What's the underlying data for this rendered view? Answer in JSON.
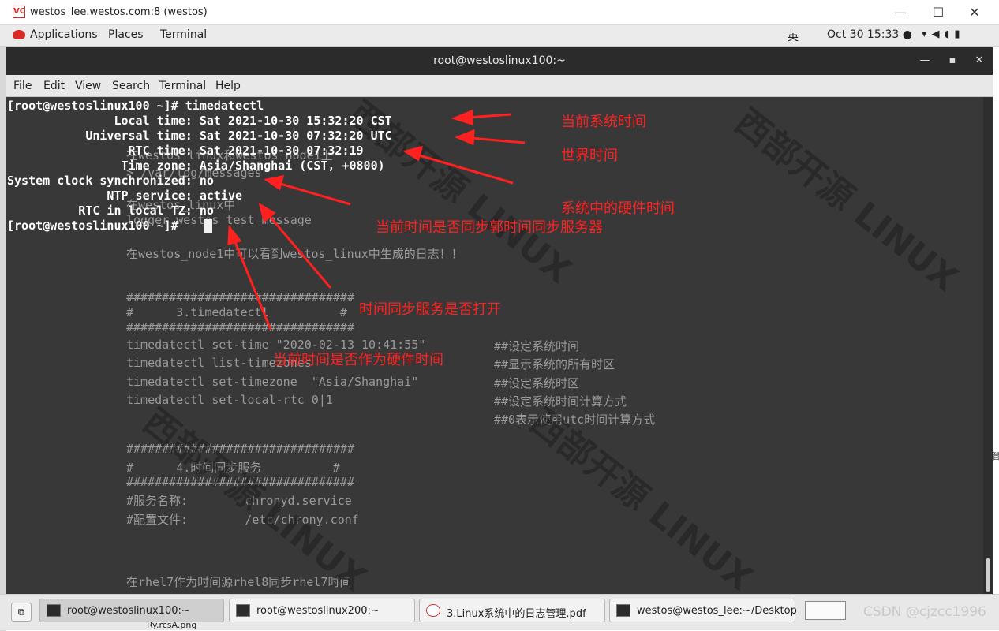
{
  "outer_window": {
    "icon_text": "VC",
    "title": "westos_lee.westos.com:8 (westos)"
  },
  "gnome_bar": {
    "applications": "Applications",
    "places": "Places",
    "terminal": "Terminal",
    "ime": "英",
    "clock": "Oct 30  15:33 ●",
    "tray": "▾◀◖▮"
  },
  "terminal_window": {
    "title": "root@westoslinux100:~",
    "menu": [
      "File",
      "Edit",
      "View",
      "Search",
      "Terminal",
      "Help"
    ]
  },
  "terminal_lines": [
    "[root@westoslinux100 ~]# timedatectl",
    "               Local time: Sat 2021-10-30 15:32:20 CST",
    "           Universal time: Sat 2021-10-30 07:32:20 UTC",
    "                 RTC time: Sat 2021-10-30 07:32:19",
    "                Time zone: Asia/Shanghai (CST, +0800)",
    "System clock synchronized: no",
    "              NTP service: active",
    "          RTC in local TZ: no",
    "[root@westoslinux100 ~]# "
  ],
  "background_doc": {
    "l1": "在westos_linux和westos_node1上",
    "l2": "> /var/log/messages",
    "l3": "在westos_linux中",
    "l4": "logger westos test message",
    "l5": "在westos_node1中可以看到westos_linux中生成的日志！！",
    "hashes": "################################",
    "sec3": "#      3.timedatectl          #",
    "cmd1": "timedatectl set-time \"2020-02-13 10:41:55\"",
    "cmd1c": "##设定系统时间",
    "cmd2": "timedatectl list-timezones",
    "cmd2c": "##显示系统的所有时区",
    "cmd3": "timedatectl set-timezone  \"Asia/Shanghai\"",
    "cmd3c": "##设定系统时区",
    "cmd4": "timedatectl set-local-rtc 0|1",
    "cmd4c": "##设定系统时间计算方式",
    "cmd5c": "##0表示使用utc时间计算方式",
    "sec4": "#      4.时间同步服务          #",
    "svc": "#服务名称:        chronyd.service",
    "conf": "#配置文件:        /etc/chrony.conf",
    "last": "在rhel7作为时间源rhel8同步rhel7时间"
  },
  "watermark": {
    "text": "西部开源 LINUX"
  },
  "annotations": {
    "a1": "当前系统时间",
    "a2": "世界时间",
    "a3": "系统中的硬件时间",
    "a4": "当前时间是否同步郭时间同步服务器",
    "a5": "时间同步服务是否打开",
    "a6": "当前时间是否作为硬件时间"
  },
  "taskbar": {
    "show_desktop": "⧉",
    "tasks": [
      "root@westoslinux100:~",
      "root@westoslinux200:~",
      "3.Linux系统中的日志管理.pdf",
      "westos@westos_lee:~/Desktop"
    ],
    "watermark": "CSDN @cjzcc1996",
    "behind_label": "Ry.rcsA.png",
    "side_char": "管"
  },
  "colors": {
    "annotation": "#ff2020",
    "terminal_bg": "#383838",
    "terminal_fg": "#ffffff"
  }
}
